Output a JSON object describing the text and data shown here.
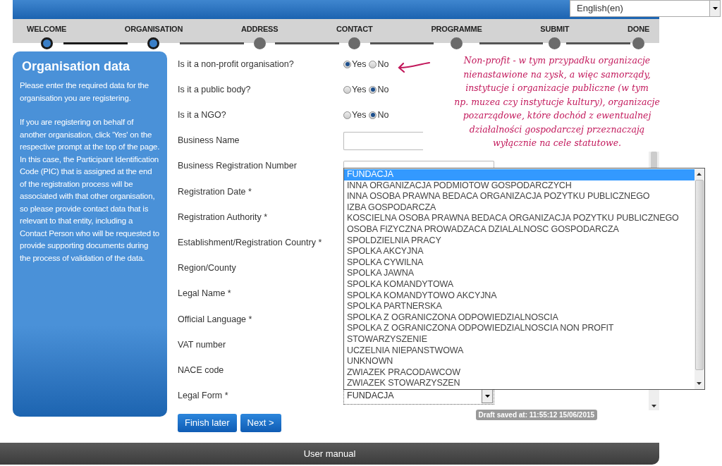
{
  "language_select": {
    "value": "English(en)"
  },
  "steps": [
    {
      "label": "WELCOME",
      "reached": true
    },
    {
      "label": "ORGANISATION",
      "reached": true
    },
    {
      "label": "ADDRESS",
      "reached": false
    },
    {
      "label": "CONTACT",
      "reached": false
    },
    {
      "label": "PROGRAMME",
      "reached": false
    },
    {
      "label": "SUBMIT",
      "reached": false
    },
    {
      "label": "DONE",
      "reached": false
    }
  ],
  "sidebar": {
    "title": "Organisation data",
    "paragraphs": [
      "Please enter the required data for the organisation you are registering.",
      "If you are registering on behalf of another organisation, click 'Yes' on the respective prompt at the top of the page. In this case, the Participant Identification Code (PIC) that is assigned at the end of the registration process will be associated with that other organisation, so please provide contact data that is relevant to that entity, including a Contact Person who will be requested to provide supporting documents during the process of validation of the data."
    ]
  },
  "fields": [
    {
      "label": "Is it a non-profit organisation?",
      "kind": "radio",
      "options": [
        {
          "label": "Yes",
          "selected": true
        },
        {
          "label": "No",
          "selected": false
        }
      ]
    },
    {
      "label": "Is it a public body?",
      "kind": "radio",
      "options": [
        {
          "label": "Yes",
          "selected": false
        },
        {
          "label": "No",
          "selected": true
        }
      ]
    },
    {
      "label": "Is it a NGO?",
      "kind": "radio",
      "options": [
        {
          "label": "Yes",
          "selected": false
        },
        {
          "label": "No",
          "selected": true
        }
      ]
    },
    {
      "label": "Business Name",
      "kind": "text"
    },
    {
      "label": "Business Registration Number",
      "kind": "covered_text"
    },
    {
      "label": "Registration Date *",
      "kind": "hidden"
    },
    {
      "label": "Registration Authority *",
      "kind": "hidden"
    },
    {
      "label": "Establishment/Registration Country *",
      "kind": "hidden"
    },
    {
      "label": "Region/County",
      "kind": "hidden"
    },
    {
      "label": "Legal Name *",
      "kind": "hidden"
    },
    {
      "label": "Official Language *",
      "kind": "hidden"
    },
    {
      "label": "VAT number",
      "kind": "hidden"
    },
    {
      "label": "NACE code",
      "kind": "hidden"
    },
    {
      "label": "Legal Form *",
      "kind": "select",
      "value": "FUNDACJA"
    }
  ],
  "legal_form_list": [
    {
      "label": "FUNDACJA",
      "selected": true
    },
    {
      "label": "INNA ORGANIZACJA PODMIOTOW GOSPODARCZYCH",
      "selected": false
    },
    {
      "label": "INNA OSOBA PRAWNA BEDACA ORGANIZACJA POZYTKU PUBLICZNEGO",
      "selected": false
    },
    {
      "label": "IZBA GOSPODARCZA",
      "selected": false
    },
    {
      "label": "KOSCIELNA OSOBA PRAWNA BEDACA ORGANIZACJA POZYTKU PUBLICZNEGO",
      "selected": false
    },
    {
      "label": "OSOBA FIZYCZNA PROWADZACA DZIALALNOSC GOSPODARCZA",
      "selected": false
    },
    {
      "label": "SPOLDZIELNIA PRACY",
      "selected": false
    },
    {
      "label": "SPOLKA AKCYJNA",
      "selected": false
    },
    {
      "label": "SPOLKA CYWILNA",
      "selected": false
    },
    {
      "label": "SPOLKA JAWNA",
      "selected": false
    },
    {
      "label": "SPOLKA KOMANDYTOWA",
      "selected": false
    },
    {
      "label": "SPOLKA KOMANDYTOWO AKCYJNA",
      "selected": false
    },
    {
      "label": "SPOLKA PARTNERSKA",
      "selected": false
    },
    {
      "label": "SPOLKA Z OGRANICZONA ODPOWIEDZIALNOSCIA",
      "selected": false
    },
    {
      "label": "SPOLKA Z OGRANICZONA ODPOWIEDZIALNOSCIA NON PROFIT",
      "selected": false
    },
    {
      "label": "STOWARZYSZENIE",
      "selected": false
    },
    {
      "label": "UCZELNIA NIEPANSTWOWA",
      "selected": false
    },
    {
      "label": "UNKNOWN",
      "selected": false
    },
    {
      "label": "ZWIAZEK PRACODAWCOW",
      "selected": false
    },
    {
      "label": "ZWIAZEK STOWARZYSZEN",
      "selected": false
    }
  ],
  "annotation": {
    "lines": [
      "Non-profit - w tym przypadku organizacje",
      "nienastawione na zysk, a więc samorządy,",
      "instytucje i organizacje publiczne (w tym",
      "np. muzea czy instytucje kultury), organizacje",
      "pozarządowe, które dochód z ewentualnej",
      "działalności gospodarczej przeznaczają",
      "wyłącznie na cele statutowe."
    ]
  },
  "buttons": [
    "Finish later",
    "Next >"
  ],
  "draft_status": "Draft saved at: 11:55:12 15/06/2015",
  "footer": {
    "link": "User manual"
  }
}
